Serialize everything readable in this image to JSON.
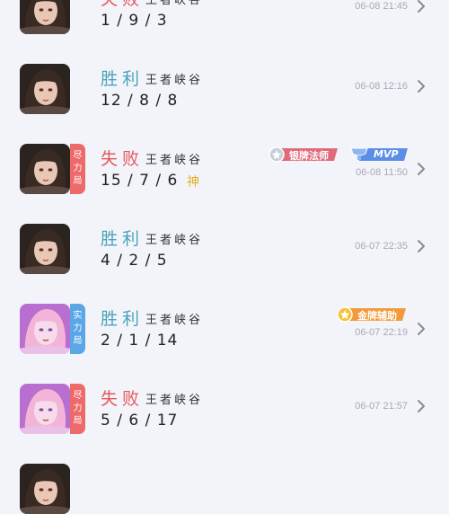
{
  "mode_label": "王者峡谷",
  "tag_chars": [
    "尽",
    "力",
    "局"
  ],
  "matches": [
    {
      "result": "失败",
      "kda": "1/9/3",
      "time": "06-08 21:45",
      "hero": "dark",
      "tag": null,
      "god": null,
      "badge_left": null,
      "badge_right": null
    },
    {
      "result": "胜利",
      "kda": "12/8/8",
      "time": "06-08 12:16",
      "hero": "dark",
      "tag": null,
      "god": null,
      "badge_left": null,
      "badge_right": null
    },
    {
      "result": "失败",
      "kda": "15/7/6",
      "time": "06-08 11:50",
      "hero": "dark",
      "tag": "尽力局",
      "god": "神",
      "badge_left": "银牌法师",
      "badge_right": "MVP"
    },
    {
      "result": "胜利",
      "kda": "4/2/5",
      "time": "06-07 22:35",
      "hero": "dark",
      "tag": null,
      "god": null,
      "badge_left": null,
      "badge_right": null
    },
    {
      "result": "胜利",
      "kda": "2/1/14",
      "time": "06-07 22:19",
      "hero": "pink",
      "tag": "实力局",
      "god": null,
      "badge_left": "金牌辅助",
      "badge_right": null
    },
    {
      "result": "失败",
      "kda": "5/6/17",
      "time": "06-07 21:57",
      "hero": "pink",
      "tag": "尽力局",
      "god": null,
      "badge_left": null,
      "badge_right": null
    }
  ],
  "colors": {
    "win": "#4aa3b9",
    "loss": "#e4595a",
    "tag_red": "#ee6a6a",
    "tag_blue": "#5aa6e6",
    "silver_badge": "#e06a7a",
    "gold_badge": "#f09a3a",
    "mvp_badge": "#5d8ee6"
  },
  "icons": [
    "chevron-right-icon",
    "hero-portrait",
    "silver-medal-icon",
    "gold-medal-icon",
    "trophy-icon"
  ]
}
